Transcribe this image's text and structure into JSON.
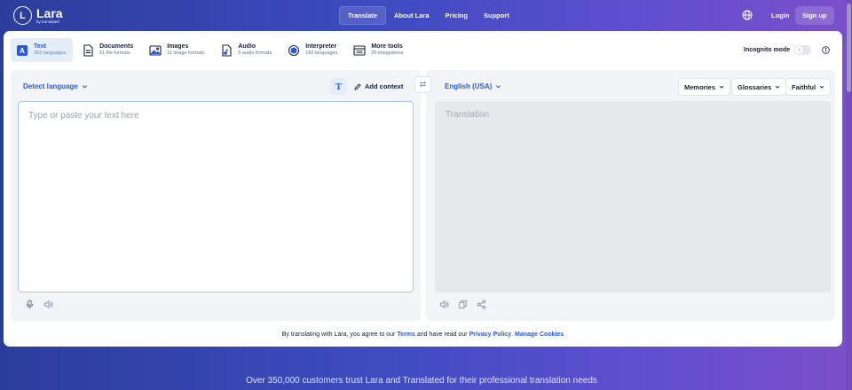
{
  "brand": {
    "name": "Lara",
    "sub": "by translated",
    "mark": "L"
  },
  "nav": {
    "links": [
      {
        "label": "Translate"
      },
      {
        "label": "About Lara"
      },
      {
        "label": "Pricing"
      },
      {
        "label": "Support"
      }
    ],
    "login": "Login",
    "signup": "Sign up"
  },
  "modes": [
    {
      "title": "Text",
      "sub": "203 languages",
      "icon": "text-icon"
    },
    {
      "title": "Documents",
      "sub": "61 file formats",
      "icon": "document-icon"
    },
    {
      "title": "Images",
      "sub": "11 image formats",
      "icon": "image-icon"
    },
    {
      "title": "Audio",
      "sub": "5 audio formats",
      "icon": "audio-file-icon"
    },
    {
      "title": "Interpreter",
      "sub": "182 languages",
      "icon": "interpreter-icon"
    },
    {
      "title": "More tools",
      "sub": "20 integrations",
      "icon": "tools-icon"
    }
  ],
  "incognito": {
    "label": "Incognito mode",
    "knob": "×"
  },
  "source": {
    "language": "Detect language",
    "t_button": "T",
    "add_context": "Add context",
    "placeholder": "Type or paste your text here"
  },
  "target": {
    "language": "English (USA)",
    "memories": "Memories",
    "glossaries": "Glossaries",
    "style": "Faithful",
    "placeholder": "Translation"
  },
  "swap_glyph": "⇄",
  "footer": {
    "prefix": "By translating with Lara, you agree to our",
    "terms": "Terms",
    "middle": "and have read our",
    "privacy": "Privacy Policy",
    "dot": ".",
    "cookies": "Manage Cookies"
  },
  "trust_text": "Over 350,000 customers trust Lara and Translated for their professional translation needs",
  "colors": {
    "accent": "#2a5bd7",
    "active_bg": "#e5edfa"
  }
}
